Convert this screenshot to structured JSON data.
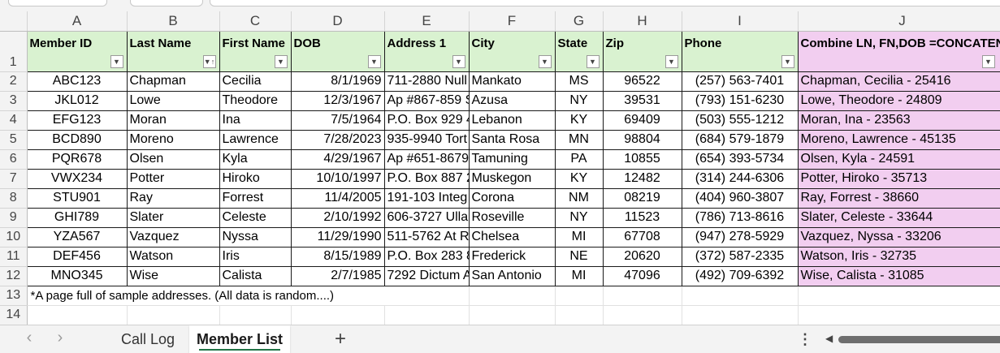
{
  "columns": [
    "A",
    "B",
    "C",
    "D",
    "E",
    "F",
    "G",
    "H",
    "I",
    "J"
  ],
  "rows": [
    "1",
    "2",
    "3",
    "4",
    "5",
    "6",
    "7",
    "8",
    "9",
    "10",
    "11",
    "12",
    "13",
    "14"
  ],
  "header": {
    "member_id": "Member ID",
    "last_name": "Last Name",
    "first_name": "First Name",
    "dob": "DOB",
    "address1": "Address 1",
    "city": "City",
    "state": "State",
    "zip": "Zip",
    "phone": "Phone",
    "combine": "Combine LN, FN,DOB  =CONCATENATE"
  },
  "records": [
    {
      "member_id": "ABC123",
      "last_name": "Chapman",
      "first_name": "Cecilia",
      "dob": "8/1/1969",
      "address1": "711-2880 Null",
      "city": "Mankato",
      "state": "MS",
      "zip": "96522",
      "phone": "(257) 563-7401",
      "combined": "Chapman, Cecilia - 25416"
    },
    {
      "member_id": "JKL012",
      "last_name": "Lowe",
      "first_name": "Theodore",
      "dob": "12/3/1967",
      "address1": "Ap #867-859 S",
      "city": "Azusa",
      "state": "NY",
      "zip": "39531",
      "phone": "(793) 151-6230",
      "combined": "Lowe, Theodore - 24809"
    },
    {
      "member_id": "EFG123",
      "last_name": "Moran",
      "first_name": "Ina",
      "dob": "7/5/1964",
      "address1": "P.O. Box 929 4",
      "city": "Lebanon",
      "state": "KY",
      "zip": "69409",
      "phone": "(503) 555-1212",
      "combined": "Moran, Ina - 23563"
    },
    {
      "member_id": "BCD890",
      "last_name": "Moreno",
      "first_name": "Lawrence",
      "dob": "7/28/2023",
      "address1": "935-9940 Tort",
      "city": "Santa Rosa",
      "state": "MN",
      "zip": "98804",
      "phone": "(684) 579-1879",
      "combined": "Moreno, Lawrence - 45135"
    },
    {
      "member_id": "PQR678",
      "last_name": "Olsen",
      "first_name": "Kyla",
      "dob": "4/29/1967",
      "address1": "Ap #651-8679",
      "city": "Tamuning",
      "state": "PA",
      "zip": "10855",
      "phone": "(654) 393-5734",
      "combined": "Olsen, Kyla - 24591"
    },
    {
      "member_id": "VWX234",
      "last_name": "Potter",
      "first_name": "Hiroko",
      "dob": "10/10/1997",
      "address1": "P.O. Box 887 2",
      "city": "Muskegon",
      "state": "KY",
      "zip": "12482",
      "phone": "(314) 244-6306",
      "combined": "Potter, Hiroko - 35713"
    },
    {
      "member_id": "STU901",
      "last_name": "Ray",
      "first_name": "Forrest",
      "dob": "11/4/2005",
      "address1": "191-103 Integ",
      "city": "Corona",
      "state": "NM",
      "zip": "08219",
      "phone": "(404) 960-3807",
      "combined": "Ray, Forrest - 38660"
    },
    {
      "member_id": "GHI789",
      "last_name": "Slater",
      "first_name": "Celeste",
      "dob": "2/10/1992",
      "address1": "606-3727 Ulla",
      "city": "Roseville",
      "state": "NY",
      "zip": "11523",
      "phone": "(786) 713-8616",
      "combined": "Slater, Celeste - 33644"
    },
    {
      "member_id": "YZA567",
      "last_name": "Vazquez",
      "first_name": "Nyssa",
      "dob": "11/29/1990",
      "address1": "511-5762 At R",
      "city": "Chelsea",
      "state": "MI",
      "zip": "67708",
      "phone": "(947) 278-5929",
      "combined": "Vazquez, Nyssa - 33206"
    },
    {
      "member_id": "DEF456",
      "last_name": "Watson",
      "first_name": "Iris",
      "dob": "8/15/1989",
      "address1": "P.O. Box 283 8",
      "city": "Frederick",
      "state": "NE",
      "zip": "20620",
      "phone": "(372) 587-2335",
      "combined": "Watson, Iris - 32735"
    },
    {
      "member_id": "MNO345",
      "last_name": "Wise",
      "first_name": "Calista",
      "dob": "2/7/1985",
      "address1": "7292 Dictum A",
      "city": "San Antonio",
      "state": "MI",
      "zip": "47096",
      "phone": "(492) 709-6392",
      "combined": "Wise, Calista - 31085"
    }
  ],
  "note": "*A page full of sample addresses.  (All data is random....)",
  "tabs": {
    "prev_icon": "chevron-left-icon",
    "next_icon": "chevron-right-icon",
    "call_log": "Call Log",
    "member_list": "Member List",
    "add_icon": "plus-icon",
    "options_icon": "more-vertical-icon"
  },
  "colors": {
    "header_green": "#d9f2d0",
    "combine_pink": "#f2cef0",
    "active_tab_underline": "#217346"
  }
}
